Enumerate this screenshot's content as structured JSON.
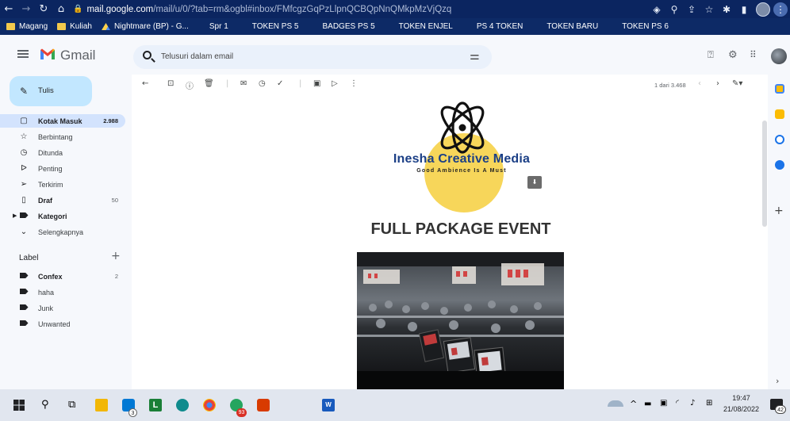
{
  "browser": {
    "url_host": "mail.google.com",
    "url_path": "/mail/u/0/?tab=rm&ogbl#inbox/FMfcgzGqPzLlpnQCBQpNnQMkpMzVjQzq"
  },
  "bookmarks": [
    {
      "label": "Magang",
      "type": "folder"
    },
    {
      "label": "Kuliah",
      "type": "folder"
    },
    {
      "label": "Nightmare (BP) - G...",
      "type": "drive"
    },
    {
      "label": "Spr 1",
      "type": "plain"
    },
    {
      "label": "TOKEN PS 5",
      "type": "plain"
    },
    {
      "label": "BADGES PS 5",
      "type": "plain"
    },
    {
      "label": "TOKEN ENJEL",
      "type": "plain"
    },
    {
      "label": "PS 4 TOKEN",
      "type": "plain"
    },
    {
      "label": "TOKEN BARU",
      "type": "plain"
    },
    {
      "label": "TOKEN PS 6",
      "type": "plain"
    }
  ],
  "gmail": {
    "app_name": "Gmail",
    "search_placeholder": "Telusuri dalam email"
  },
  "sidebar": {
    "compose_label": "Tulis",
    "items": [
      {
        "label": "Kotak Masuk",
        "count": "2.988",
        "icon": "inbox-icon",
        "glyph": "▢"
      },
      {
        "label": "Berbintang",
        "count": "",
        "icon": "star-icon",
        "glyph": "☆"
      },
      {
        "label": "Ditunda",
        "count": "",
        "icon": "clock-icon",
        "glyph": "◷"
      },
      {
        "label": "Penting",
        "count": "",
        "icon": "important-icon",
        "glyph": "ᐅ"
      },
      {
        "label": "Terkirim",
        "count": "",
        "icon": "send-icon",
        "glyph": "➢"
      },
      {
        "label": "Draf",
        "count": "50",
        "icon": "draft-icon",
        "glyph": "▯"
      },
      {
        "label": "Kategori",
        "count": "",
        "icon": "category-label-icon",
        "glyph": ""
      },
      {
        "label": "Selengkapnya",
        "count": "",
        "icon": "chevron-down-icon",
        "glyph": "⌄"
      }
    ],
    "labels_title": "Label",
    "labels": [
      {
        "label": "Confex",
        "count": "2"
      },
      {
        "label": "haha",
        "count": ""
      },
      {
        "label": "Junk",
        "count": ""
      },
      {
        "label": "Unwanted",
        "count": ""
      }
    ]
  },
  "toolbar": {
    "page_info": "1 dari 3.468"
  },
  "email": {
    "brand_name": "Inesha Creative Media",
    "brand_tagline": "Good Ambience Is A Must",
    "heading": "FULL PACKAGE EVENT"
  },
  "taskbar": {
    "time": "19:47",
    "date": "21/08/2022",
    "notification_count": "42",
    "badge_a": "3",
    "badge_b": "93"
  },
  "colors": {
    "chrome_bg": "#0b2560",
    "compose_bg": "#c2e7ff",
    "active_item_bg": "#d3e3fd",
    "logo_yellow": "#f7d65a",
    "logo_blue": "#1b3f86"
  }
}
